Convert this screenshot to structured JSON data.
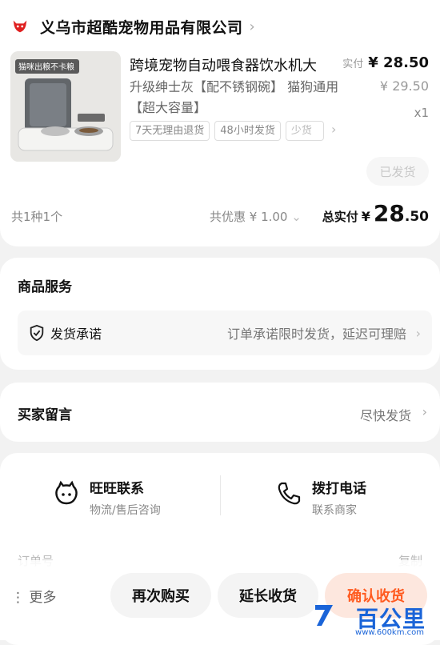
{
  "shop": {
    "name": "义乌市超酷宠物用品有限公司"
  },
  "product": {
    "title": "跨境宠物自动喂食器饮水机大",
    "spec": "升级绅士灰【配不锈钢碗】 猫狗通用【超大容量】",
    "image_text": "猫咪出粮不卡粮",
    "paid_label": "实付",
    "paid_price": "¥ 28.50",
    "original_price": "¥ 29.50",
    "quantity": "x1",
    "tags": [
      "7天无理由退货",
      "48小时发货",
      "少货"
    ],
    "status_button": "已发货"
  },
  "summary": {
    "count": "共1种1个",
    "discount": "共优惠 ¥ 1.00",
    "total_label": "总实付",
    "total_currency": "¥",
    "total_int": "28",
    "total_dec": ".50"
  },
  "service": {
    "title": "商品服务",
    "item_name": "发货承诺",
    "item_desc": "订单承诺限时发货，延迟可理赔"
  },
  "message": {
    "title": "买家留言",
    "value": "尽快发货"
  },
  "contact": {
    "wangwang_title": "旺旺联系",
    "wangwang_sub": "物流/售后咨询",
    "phone_title": "拨打电话",
    "phone_sub": "联系商家",
    "peek_left": "订单号",
    "peek_right": "复制"
  },
  "bottom": {
    "more": "更多",
    "rebuy": "再次购买",
    "extend": "延长收货",
    "confirm": "确认收货"
  },
  "watermark": {
    "text": "百公里",
    "url": "www.600km.com"
  },
  "colors": {
    "brand_red": "#e02020",
    "accent_orange": "#ff5a1f",
    "watermark_blue": "#1a64d8"
  }
}
